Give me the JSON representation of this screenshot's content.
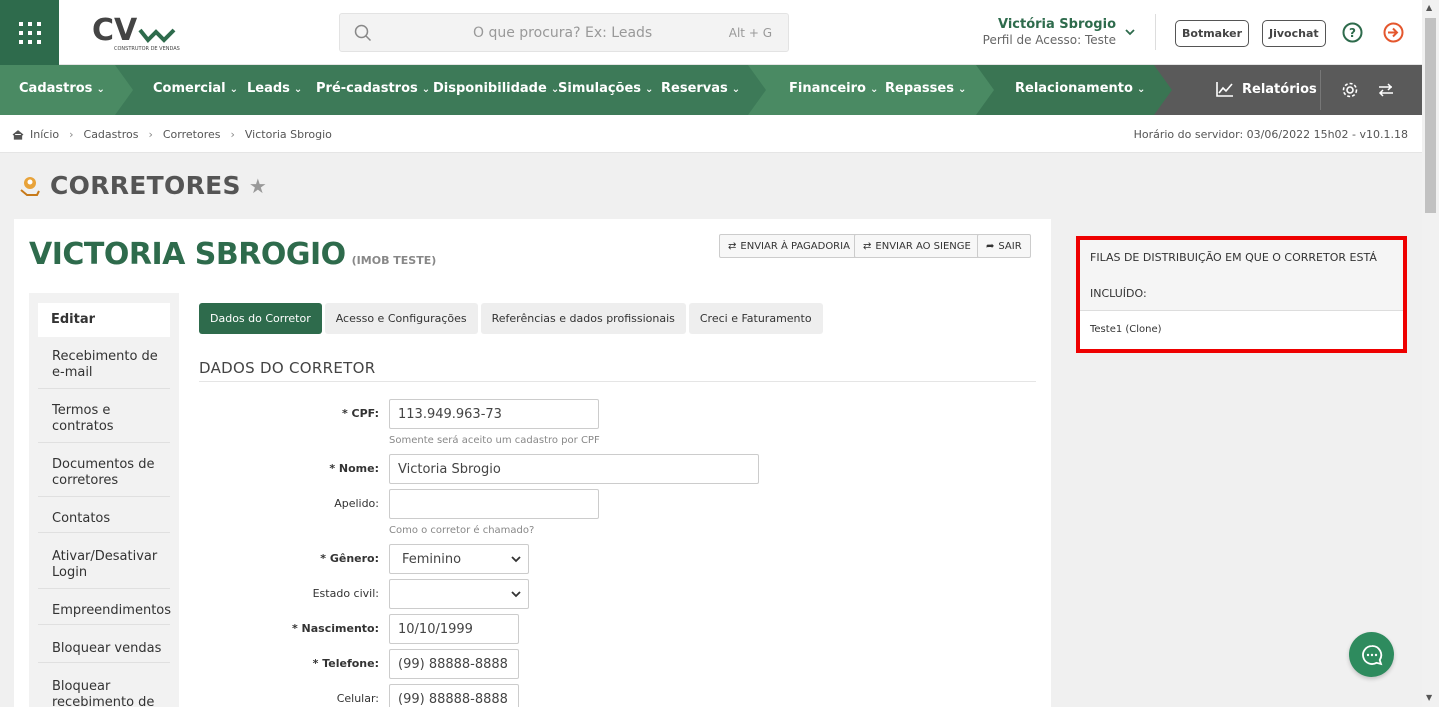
{
  "header": {
    "logo_text": "CV",
    "logo_sub": "CONSTRUTOR DE VENDAS",
    "search_placeholder": "O que procura? Ex: Leads",
    "search_shortcut": "Alt + G",
    "user_name": "Victória Sbrogio",
    "user_profile": "Perfil de Acesso: Teste",
    "btn_botmaker": "Botmaker",
    "btn_jivochat": "Jivochat"
  },
  "nav": {
    "items": [
      "Cadastros",
      "Comercial",
      "Leads",
      "Pré-cadastros",
      "Disponibilidade",
      "Simulações",
      "Reservas",
      "Financeiro",
      "Repasses",
      "Relacionamento"
    ],
    "reports": "Relatórios"
  },
  "breadcrumb": {
    "items": [
      "Início",
      "Cadastros",
      "Corretores",
      "Victoria Sbrogio"
    ],
    "server_time": "Horário do servidor: 03/06/2022 15h02 - v10.1.18"
  },
  "page": {
    "title": "CORRETORES",
    "name": "VICTORIA SBROGIO",
    "company": "(IMOB TESTE)",
    "actions": [
      "ENVIAR À PAGADORIA",
      "ENVIAR AO SIENGE",
      "SAIR"
    ]
  },
  "sidebar": {
    "active": "Editar",
    "items": [
      "Recebimento de e-mail",
      "Termos e contratos",
      "Documentos de corretores",
      "Contatos",
      "Ativar/Desativar Login",
      "Empreendimentos",
      "Bloquear vendas",
      "Bloquear recebimento de"
    ]
  },
  "tabs": [
    "Dados do Corretor",
    "Acesso e Configurações",
    "Referências e dados profissionais",
    "Creci e Faturamento"
  ],
  "form": {
    "section_title": "DADOS DO CORRETOR",
    "cpf_label": "* CPF:",
    "cpf_value": "113.949.963-73",
    "cpf_hint": "Somente será aceito um cadastro por CPF",
    "nome_label": "* Nome:",
    "nome_value": "Victoria Sbrogio",
    "apelido_label": "Apelido:",
    "apelido_value": "",
    "apelido_hint": "Como o corretor é chamado?",
    "genero_label": "* Gênero:",
    "genero_value": "Feminino",
    "estado_label": "Estado civil:",
    "estado_value": "",
    "nasc_label": "* Nascimento:",
    "nasc_value": "10/10/1999",
    "tel_label": "* Telefone:",
    "tel_value": "(99) 88888-8888",
    "cel_label": "Celular:",
    "cel_value": "(99) 88888-8888"
  },
  "queue_panel": {
    "title_line1": "FILAS DE DISTRIBUIÇÃO EM QUE O CORRETOR ESTÁ",
    "title_line2": "INCLUÍDO:",
    "entries": [
      "Teste1 (Clone)"
    ]
  },
  "colors": {
    "brand_green": "#2e6b4c",
    "highlight_red": "#ee0000"
  }
}
